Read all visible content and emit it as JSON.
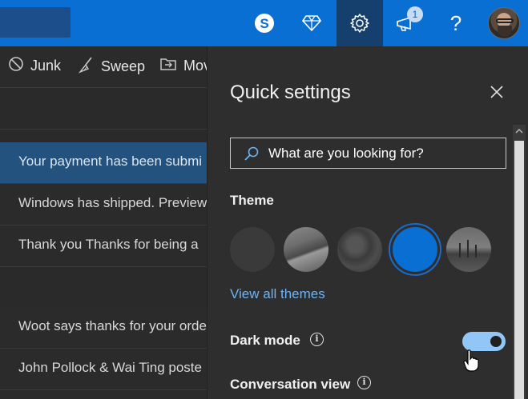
{
  "topbar": {
    "icons": [
      "skype-icon",
      "premium-diamond-icon",
      "settings-gear-icon",
      "whats-new-megaphone-icon",
      "help-icon",
      "avatar"
    ],
    "notification_count": "1",
    "help_glyph": "?"
  },
  "commands": {
    "junk": "Junk",
    "sweep": "Sweep",
    "move": "Mov"
  },
  "messages": [
    "Your payment has been submi",
    "Windows has shipped. Preview",
    "Thank you   Thanks for being a",
    "Woot says thanks for your orde",
    "John Pollock & Wai Ting poste"
  ],
  "quick_settings": {
    "title": "Quick settings",
    "search_placeholder": "What are you looking for?",
    "theme_label": "Theme",
    "view_all_themes": "View all themes",
    "dark_mode_label": "Dark mode",
    "dark_mode_on": true,
    "conversation_view_label": "Conversation view",
    "info_glyph": "i"
  },
  "colors": {
    "accent": "#0a6fd3",
    "link": "#6fb3f2",
    "toggle_on": "#91c6f6",
    "selected_row": "#23527e"
  }
}
